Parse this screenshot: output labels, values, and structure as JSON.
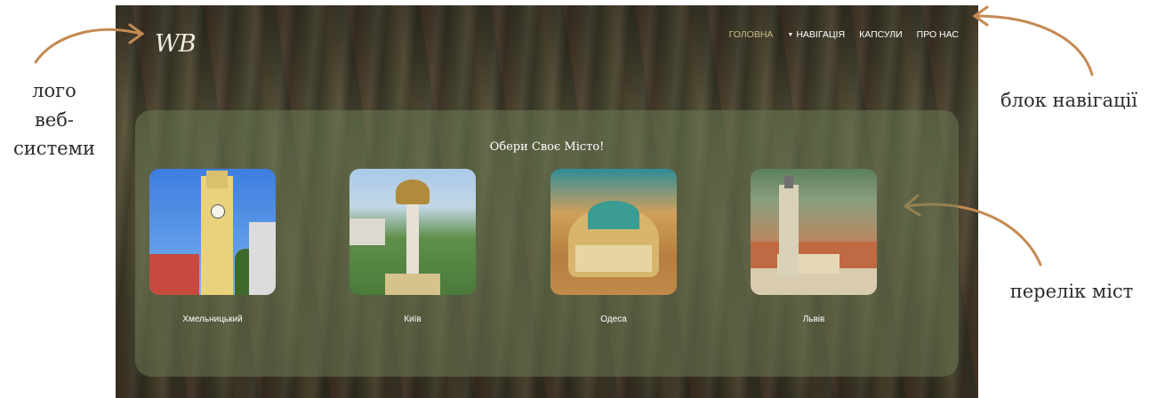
{
  "annotations": {
    "logo_note": [
      "лого",
      "веб-",
      "системи"
    ],
    "nav_note": "блок навігації",
    "cities_note": "перелік міст"
  },
  "site": {
    "logo_text": "WB",
    "nav": {
      "items": [
        {
          "label": "ГОЛОВНА",
          "active": true
        },
        {
          "label": "НАВІГАЦІЯ",
          "active": false,
          "has_dropdown": true
        },
        {
          "label": "КАПСУЛИ",
          "active": false
        },
        {
          "label": "ПРО НАС",
          "active": false
        }
      ]
    },
    "panel": {
      "title": "Обери Своє Місто!",
      "cities": [
        {
          "name": "Хмельницький"
        },
        {
          "name": "Київ"
        },
        {
          "name": "Одеса"
        },
        {
          "name": "Львів"
        }
      ]
    }
  },
  "colors": {
    "arrow": "#c48a52",
    "active_nav": "#c8b98b",
    "panel": "#6c7a54"
  }
}
